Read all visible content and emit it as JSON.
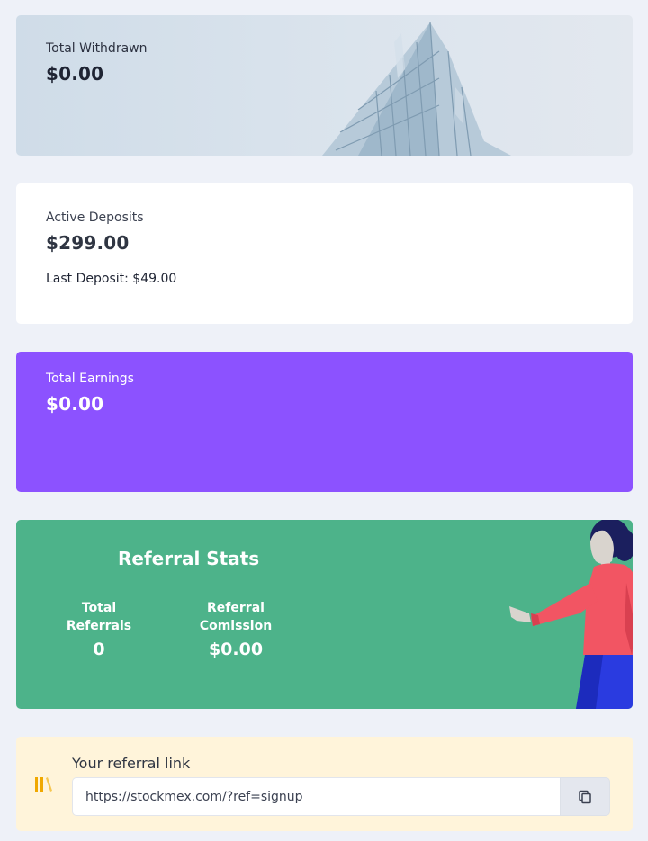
{
  "withdrawn_card": {
    "label": "Total Withdrawn",
    "amount": "$0.00"
  },
  "deposits_card": {
    "label": "Active Deposits",
    "amount": "$299.00",
    "last_deposit": "Last Deposit: $49.00"
  },
  "earnings_card": {
    "label": "Total Earnings",
    "amount": "$0.00",
    "color": "#8c52ff"
  },
  "referral_stats": {
    "title": "Referral Stats",
    "color": "#4db38a",
    "total_referrals_label": "Total Referrals",
    "total_referrals_value": "0",
    "commission_label": "Referral Comission",
    "commission_value": "$0.00"
  },
  "referral_link": {
    "heading": "Your referral link",
    "url": "https://stockmex.com/?ref=signup",
    "icon": "books-icon",
    "copy_icon": "copy-icon"
  }
}
